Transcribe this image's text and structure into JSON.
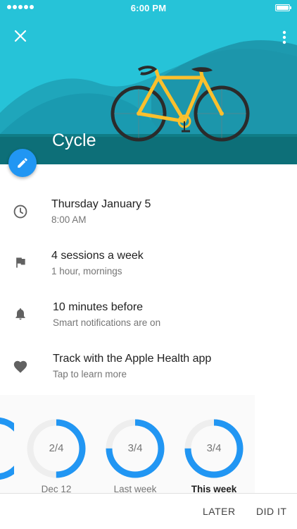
{
  "status_bar": {
    "time": "6:00 PM"
  },
  "header": {
    "title": "Cycle",
    "close_icon": "close-icon",
    "more_icon": "more-vertical-icon",
    "edit_icon": "pencil-icon"
  },
  "details": [
    {
      "icon": "clock-icon",
      "title": "Thursday January 5",
      "subtitle": "8:00 AM"
    },
    {
      "icon": "flag-icon",
      "title": "4 sessions a week",
      "subtitle": "1 hour, mornings"
    },
    {
      "icon": "bell-icon",
      "title": "10 minutes before",
      "subtitle": "Smart notifications are on"
    },
    {
      "icon": "heart-icon",
      "title": "Track with the Apple Health app",
      "subtitle": "Tap to learn more"
    }
  ],
  "progress": [
    {
      "label": "Dec 12",
      "value": "2/4",
      "fraction": 0.5
    },
    {
      "label": "Last week",
      "value": "3/4",
      "fraction": 0.75
    },
    {
      "label": "This week",
      "value": "3/4",
      "fraction": 0.75
    }
  ],
  "actions": {
    "later": "LATER",
    "did_it": "DID IT"
  },
  "colors": {
    "hero_sky": "#26c3d8",
    "accent": "#2196f3",
    "ring_track": "#eeeeee",
    "bike_frame": "#fbc02d"
  }
}
